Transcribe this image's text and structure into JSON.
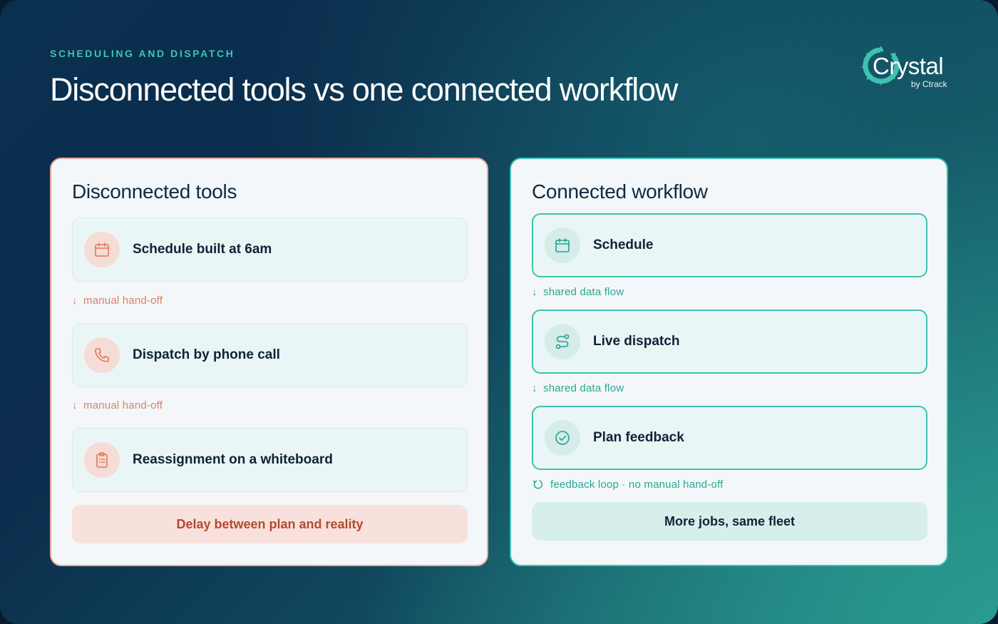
{
  "header": {
    "eyebrow": "SCHEDULING AND DISPATCH",
    "title": "Disconnected tools vs one connected workflow"
  },
  "logo": {
    "wordmark": "Crystal",
    "byline": "by Ctrack"
  },
  "colors": {
    "accent_teal": "#3fc4b2",
    "warning_coral": "#d98068",
    "outcome_red": "#b44a2e",
    "ink": "#0f2338"
  },
  "left_panel": {
    "title": "Disconnected tools",
    "steps": [
      {
        "label": "Schedule built at 6am",
        "icon": "calendar-icon"
      },
      {
        "label": "Dispatch by phone call",
        "icon": "phone-icon"
      },
      {
        "label": "Reassignment on a whiteboard",
        "icon": "clipboard-icon"
      }
    ],
    "connector_arrow": "↓",
    "connectors": [
      "manual hand-off",
      "manual hand-off"
    ],
    "outcome": "Delay between plan and reality"
  },
  "right_panel": {
    "title": "Connected workflow",
    "steps": [
      {
        "label": "Schedule",
        "icon": "calendar-icon"
      },
      {
        "label": "Live dispatch",
        "icon": "route-icon"
      },
      {
        "label": "Plan feedback",
        "icon": "check-circle-icon"
      }
    ],
    "connector_arrow": "↓",
    "connectors": [
      "shared data flow",
      "shared data flow"
    ],
    "loop_note": "feedback loop · no manual hand-off",
    "outcome": "More jobs, same fleet"
  }
}
